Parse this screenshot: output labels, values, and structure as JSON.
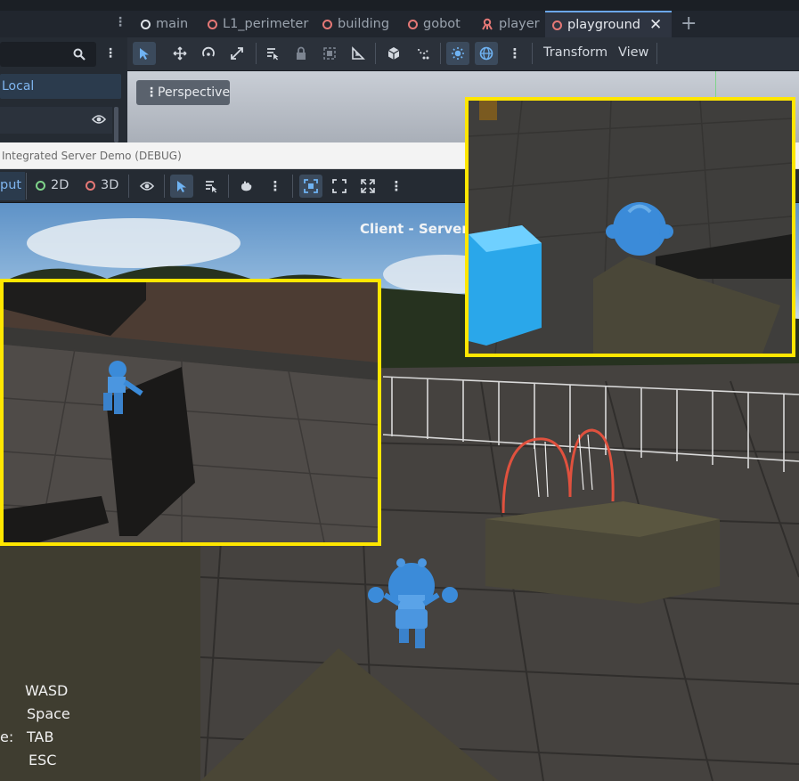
{
  "editor": {
    "tabs": [
      {
        "label": "main",
        "icon": "scene-ring-white-icon",
        "active": false
      },
      {
        "label": "L1_perimeter",
        "icon": "scene-ring-icon",
        "active": false
      },
      {
        "label": "building",
        "icon": "scene-ring-icon",
        "active": false
      },
      {
        "label": "gobot",
        "icon": "scene-ring-icon",
        "active": false
      },
      {
        "label": "player",
        "icon": "player-scene-icon",
        "active": false
      },
      {
        "label": "playground",
        "icon": "scene-ring-icon",
        "active": true
      }
    ],
    "add_tab_symbol": "+",
    "close_tab_symbol": "✕",
    "left_panel": {
      "space_label": "Local"
    },
    "viewport_menu": {
      "transform_label": "Transform",
      "view_label": "View",
      "perspective_label": "Perspective"
    }
  },
  "game_window": {
    "title": "Integrated Server Demo (DEBUG)",
    "toolbar": {
      "input_label": "put",
      "mode_2d_label": "2D",
      "mode_3d_label": "3D"
    },
    "status_text": "Client - Server",
    "controls": {
      "rows": [
        {
          "prefix": "",
          "key": "WASD"
        },
        {
          "prefix": "",
          "key": "Space"
        },
        {
          "prefix": "e:",
          "key": "TAB"
        },
        {
          "prefix": "",
          "key": "ESC"
        }
      ]
    }
  },
  "colors": {
    "accent": "#6ba7ea",
    "inset_border": "#ffe600",
    "scene_ring": "#e57876",
    "mode_2d_ring": "#7fd48a",
    "robot_blue": "#3b8bd9",
    "cube_blue": "#2aa7ea",
    "swing_red": "#e0513e"
  }
}
